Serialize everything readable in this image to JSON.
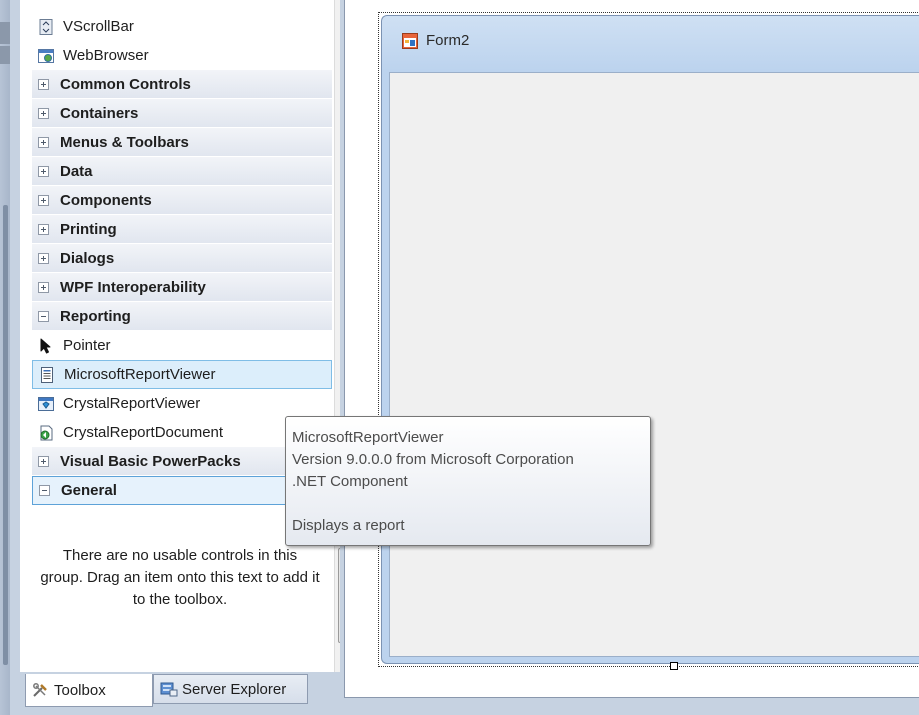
{
  "toolbox": {
    "items_top": [
      {
        "label": "VScrollBar",
        "icon": "vscrollbar-icon"
      },
      {
        "label": "WebBrowser",
        "icon": "webbrowser-icon"
      }
    ],
    "categories_collapsed": [
      "Common Controls",
      "Containers",
      "Menus & Toolbars",
      "Data",
      "Components",
      "Printing",
      "Dialogs",
      "WPF Interoperability"
    ],
    "reporting": {
      "label": "Reporting",
      "items": [
        {
          "label": "Pointer",
          "icon": "pointer-icon"
        },
        {
          "label": "MicrosoftReportViewer",
          "icon": "report-viewer-icon",
          "selected": true
        },
        {
          "label": "CrystalReportViewer",
          "icon": "crystal-viewer-icon"
        },
        {
          "label": "CrystalReportDocument",
          "icon": "crystal-document-icon"
        }
      ]
    },
    "vb_powerpacks": "Visual Basic PowerPacks",
    "general": "General",
    "empty_message": "There are no usable controls in this group. Drag an item onto this text to add it to the toolbox."
  },
  "tabs": {
    "toolbox": "Toolbox",
    "server_explorer": "Server Explorer"
  },
  "designer": {
    "form_title": "Form2"
  },
  "tooltip": {
    "name": "MicrosoftReportViewer",
    "version": "Version 9.0.0.0 from Microsoft Corporation",
    "type": ".NET Component",
    "description": "Displays a report"
  },
  "colors": {
    "chrome": "#c6d2e1",
    "selection": "#dceefb",
    "selection_border": "#7fbde6",
    "form_caption": "#bcd3ee"
  }
}
